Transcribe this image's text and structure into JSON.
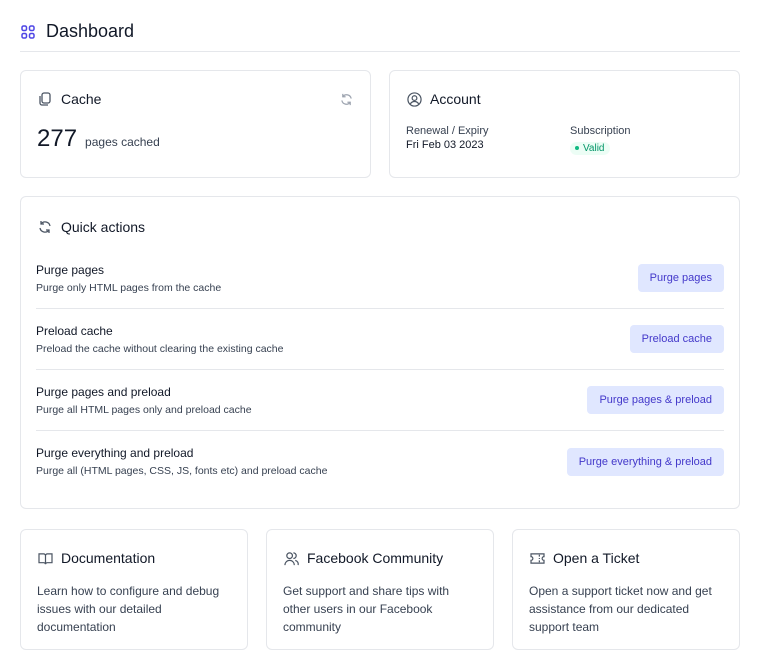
{
  "header": {
    "title": "Dashboard"
  },
  "cache": {
    "title": "Cache",
    "count": "277",
    "label": "pages cached"
  },
  "account": {
    "title": "Account",
    "renewal_label": "Renewal / Expiry",
    "renewal_value": "Fri Feb 03 2023",
    "subscription_label": "Subscription",
    "subscription_status": "Valid"
  },
  "quick_actions": {
    "title": "Quick actions",
    "items": [
      {
        "title": "Purge pages",
        "desc": "Purge only HTML pages from the cache",
        "button": "Purge pages"
      },
      {
        "title": "Preload cache",
        "desc": "Preload the cache without clearing the existing cache",
        "button": "Preload cache"
      },
      {
        "title": "Purge pages and preload",
        "desc": "Purge all HTML pages only and preload cache",
        "button": "Purge pages & preload"
      },
      {
        "title": "Purge everything and preload",
        "desc": "Purge all (HTML pages, CSS, JS, fonts etc) and preload cache",
        "button": "Purge everything & preload"
      }
    ]
  },
  "links": [
    {
      "title": "Documentation",
      "desc": "Learn how to configure and debug issues with our detailed documentation"
    },
    {
      "title": "Facebook Community",
      "desc": "Get support and share tips with other users in our Facebook community"
    },
    {
      "title": "Open a Ticket",
      "desc": "Open a support ticket now and get assistance from our dedicated support team"
    }
  ]
}
